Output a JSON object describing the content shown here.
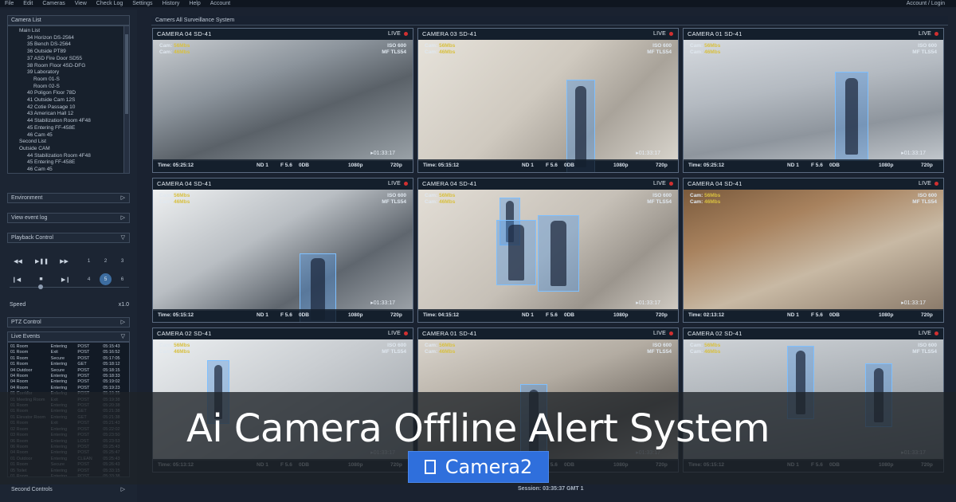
{
  "menu": {
    "items": [
      "File",
      "Edit",
      "Cameras",
      "View",
      "Check Log",
      "Settings",
      "History",
      "Help",
      "Account"
    ],
    "account_action": "Account / Login"
  },
  "sidebar": {
    "camera_list_title": "Camera List",
    "tree": [
      "Main List",
      "34 Horizon DS-2564",
      "35 Bench DS-2564",
      "36 Outside PT89",
      "37 ASD Fire Door SD55",
      "38 Room Floor 4SD-DFG",
      "39 Laboratory",
      "Room 01-S",
      "Room 02-S",
      "40 Poligon Floor 78D",
      "41 Outside Cam 12S",
      "42 Cotie Passage 10",
      "43 American Hall 12",
      "44 Stabilization Room 4F48",
      "45 Entering FF-458E",
      "46 Cam 45",
      "Second List",
      "Outside CAM",
      "44 Stabilization Room 4F48",
      "45 Entering FF-458E",
      "46 Cam 45"
    ],
    "environment": "Environment",
    "view_event_log": "View event log",
    "playback_control": "Playback Control",
    "playback_numbers": [
      "1",
      "2",
      "3",
      "4",
      "5",
      "6"
    ],
    "active_number": "5",
    "speed_label": "Speed",
    "speed_value": "x1.0",
    "ptz_control": "PTZ Control",
    "live_events": "Live Events",
    "events": [
      [
        "01 Room",
        "Entering",
        "POST",
        "05:15:43"
      ],
      [
        "01 Room",
        "Exit",
        "POST",
        "05:16:52"
      ],
      [
        "01 Room",
        "Secure",
        "POST",
        "05:17:05"
      ],
      [
        "01 Room",
        "Entering",
        "GET",
        "05:18:12"
      ],
      [
        "04 Outdoor",
        "Secure",
        "POST",
        "05:18:15"
      ],
      [
        "04 Room",
        "Entering",
        "POST",
        "05:18:33"
      ],
      [
        "04 Room",
        "Entering",
        "POST",
        "05:19:02"
      ],
      [
        "04 Room",
        "Entering",
        "POST",
        "05:19:23"
      ],
      [
        "01 Corridor",
        "Entering",
        "POST",
        "05:19:35"
      ],
      [
        "01 Meeting Room",
        "Exit",
        "POST",
        "05:19:38"
      ],
      [
        "01 Room",
        "Entering",
        "POST",
        "05:20:38"
      ],
      [
        "01 Room",
        "Entering",
        "GET",
        "05:21:38"
      ],
      [
        "01 Elevator Room",
        "Entering",
        "GET",
        "05:21:38"
      ],
      [
        "01 Room",
        "Exit",
        "POST",
        "05:21:43"
      ],
      [
        "02 Room",
        "Entering",
        "POST",
        "05:22:02"
      ],
      [
        "03 Room",
        "Entering",
        "POST",
        "05:23:50"
      ],
      [
        "06 Room",
        "Entering",
        "LOST",
        "05:23:53"
      ],
      [
        "06 Room",
        "Entering",
        "POST",
        "05:25:43"
      ],
      [
        "04 Room",
        "Entering",
        "POST",
        "05:25:47"
      ],
      [
        "01 Outdoor",
        "Entering",
        "CLEAN",
        "05:25:43"
      ],
      [
        "01 Room",
        "Secure",
        "POST",
        "05:26:43"
      ],
      [
        "05 Toilet",
        "Entering",
        "POST",
        "05:33:15"
      ],
      [
        "01 Room",
        "Entering",
        "POST",
        "05:33:38"
      ],
      [
        "01 Room",
        "Entering",
        "POST",
        "05:33:43"
      ]
    ],
    "second_controls": "Second Controls"
  },
  "main": {
    "title": "Camers All Surveillance System",
    "live_label": "LIVE",
    "cams": [
      {
        "name": "CAMERA 04 SD-41",
        "time": "Time: 05:25:12",
        "clock": "01:33:17",
        "res1": "1080p",
        "res2": "720p"
      },
      {
        "name": "CAMERA 03 SD-41",
        "time": "Time: 05:15:12",
        "clock": "01:33:17",
        "res1": "1080p",
        "res2": "720p"
      },
      {
        "name": "CAMERA 01 SD-41",
        "time": "Time: 05:25:12",
        "clock": "01:33:17",
        "res1": "1080p",
        "res2": "720p"
      },
      {
        "name": "CAMERA 04 SD-41",
        "time": "Time: 05:15:12",
        "clock": "01:33:17",
        "res1": "1080p",
        "res2": "720p"
      },
      {
        "name": "CAMERA 04 SD-41",
        "time": "Time: 04:15:12",
        "clock": "01:33:17",
        "res1": "1080p",
        "res2": "720p"
      },
      {
        "name": "CAMERA 04 SD-41",
        "time": "Time: 02:13:12",
        "clock": "01:33:17",
        "res1": "1080p",
        "res2": "720p"
      },
      {
        "name": "CAMERA 02 SD-41",
        "time": "Time: 05:13:12",
        "clock": "01:33:17",
        "res1": "1080p",
        "res2": "720p"
      },
      {
        "name": "CAMERA 01 SD-41",
        "time": "Time: 05:15:12",
        "clock": "01:33:17",
        "res1": "1080p",
        "res2": "720p"
      },
      {
        "name": "CAMERA 02 SD-41",
        "time": "Time: 05:15:12",
        "clock": "01:33:17",
        "res1": "1080p",
        "res2": "720p"
      }
    ],
    "cam_meta": {
      "cam1_label": "Cam:",
      "cam1_value": "56Mbs",
      "cam2_label": "Cam:",
      "cam2_value": "46Mbs",
      "iso": "ISO 600",
      "mf": "MF TLS54",
      "nd": "ND 1",
      "fstop": "F 5.6",
      "db": "0DB"
    },
    "session": "Session: 03:35:37 GMT 1"
  },
  "overlay": {
    "headline": "Ai Camera Offline Alert System",
    "category": "Camera2"
  },
  "colors": {
    "accent": "#2f6fdc",
    "live_dot": "#d23030",
    "detection": "#7fc0ff",
    "bitrate": "#d8c040"
  }
}
